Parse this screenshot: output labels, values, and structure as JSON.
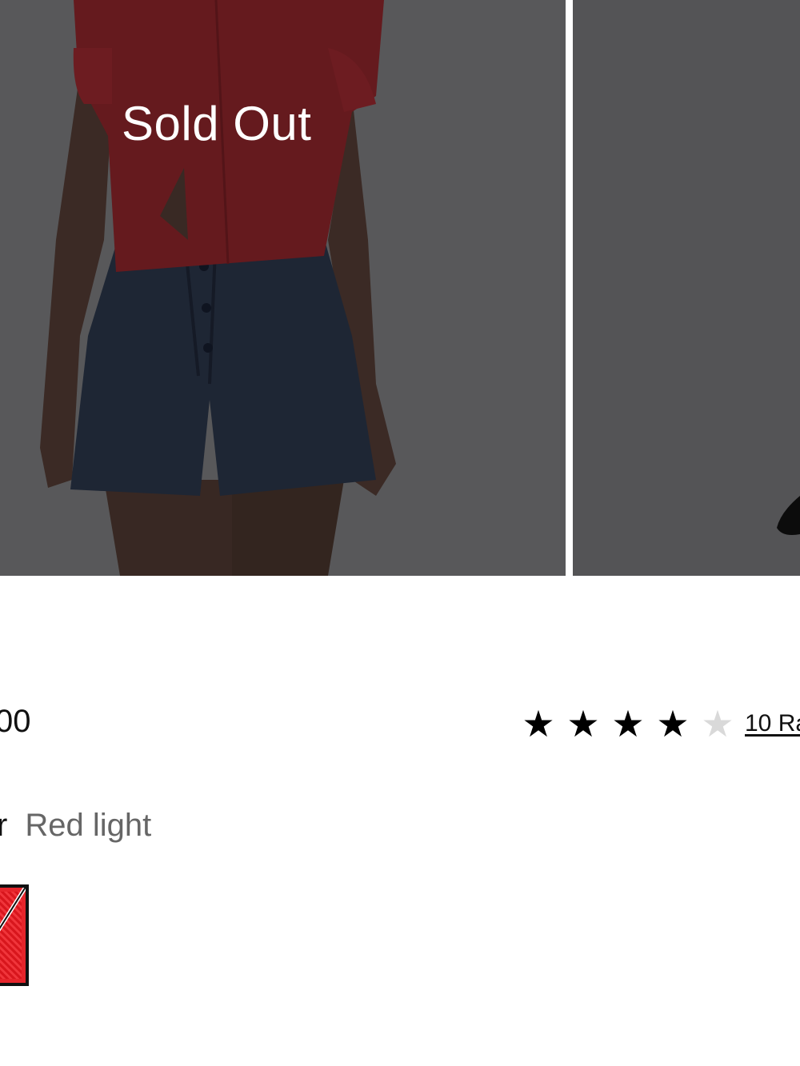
{
  "product_images": {
    "overlay_label": "Sold Out"
  },
  "product": {
    "price_partial": "00",
    "rating": {
      "stars_filled": 4,
      "stars_total": 5,
      "link_text_partial": "10 Ra"
    },
    "color": {
      "label_partial": "r",
      "value": "Red light"
    },
    "swatch": {
      "name": "Red light",
      "color": "#e5252b",
      "state": "selected-unavailable"
    }
  },
  "icons": {
    "star_filled": "star-filled-icon",
    "star_empty": "star-empty-icon"
  }
}
